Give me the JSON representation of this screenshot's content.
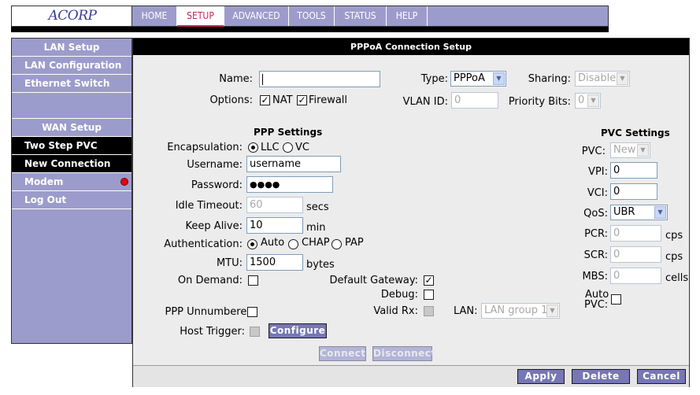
{
  "brand": {
    "logo_text": "ACORP"
  },
  "nav": {
    "tabs": [
      {
        "label": "HOME",
        "active": false
      },
      {
        "label": "SETUP",
        "active": true
      },
      {
        "label": "ADVANCED",
        "active": false
      },
      {
        "label": "TOOLS",
        "active": false
      },
      {
        "label": "STATUS",
        "active": false
      },
      {
        "label": "HELP",
        "active": false
      }
    ]
  },
  "sidebar": {
    "items": [
      {
        "label": "LAN Setup"
      },
      {
        "label": "LAN Configuration"
      },
      {
        "label": "Ethernet Switch"
      },
      {
        "label": "WAN Setup"
      },
      {
        "label": "Two Step PVC"
      },
      {
        "label": "New Connection"
      },
      {
        "label": "Modem"
      },
      {
        "label": "Log Out"
      }
    ]
  },
  "panel": {
    "title": "PPPoA Connection Setup",
    "name_label": "Name:",
    "name_value": "",
    "type_label": "Type:",
    "type_value": "PPPoA",
    "sharing_label": "Sharing:",
    "sharing_value": "Disable",
    "options_label": "Options:",
    "nat_label": "NAT",
    "firewall_label": "Firewall",
    "vlan_label": "VLAN ID:",
    "vlan_value": "0",
    "priority_label": "Priority Bits:",
    "priority_value": "0",
    "ppp_title": "PPP Settings",
    "encap_label": "Encapsulation:",
    "llc_label": "LLC",
    "vc_label": "VC",
    "username_label": "Username:",
    "username_value": "username",
    "password_label": "Password:",
    "password_value": "●●●●",
    "idle_label": "Idle Timeout:",
    "idle_value": "60",
    "idle_unit": "secs",
    "keepalive_label": "Keep Alive:",
    "keepalive_value": "10",
    "keepalive_unit": "min",
    "auth_label": "Authentication:",
    "auth_auto": "Auto",
    "auth_chap": "CHAP",
    "auth_pap": "PAP",
    "mtu_label": "MTU:",
    "mtu_value": "1500",
    "mtu_unit": "bytes",
    "ondemand_label": "On Demand:",
    "defgw_label": "Default Gateway:",
    "debug_label": "Debug:",
    "pppunnum_label": "PPP Unnumbered:",
    "validrx_label": "Valid Rx:",
    "lan_label": "LAN:",
    "lan_value": "LAN group 1",
    "hosttrigger_label": "Host Trigger:",
    "configure_btn": "Configure",
    "connect_btn": "Connect",
    "disconnect_btn": "Disconnect",
    "pvc_title": "PVC Settings",
    "pvc_label": "PVC:",
    "pvc_value": "New",
    "vpi_label": "VPI:",
    "vpi_value": "0",
    "vci_label": "VCI:",
    "vci_value": "0",
    "qos_label": "QoS:",
    "qos_value": "UBR",
    "pcr_label": "PCR:",
    "pcr_value": "0",
    "pcr_unit": "cps",
    "scr_label": "SCR:",
    "scr_value": "0",
    "scr_unit": "cps",
    "mbs_label": "MBS:",
    "mbs_value": "0",
    "mbs_unit": "cells",
    "autopvc_label_1": "Auto",
    "autopvc_label_2": "PVC:"
  },
  "footer": {
    "apply": "Apply",
    "delete": "Delete",
    "cancel": "Cancel"
  },
  "colors": {
    "nav_bg": "#9c9ccc",
    "active_tab": "#c0245a",
    "status_dot": "#e4001b"
  },
  "icons": {
    "modem_status": "red-status-dot-icon"
  }
}
